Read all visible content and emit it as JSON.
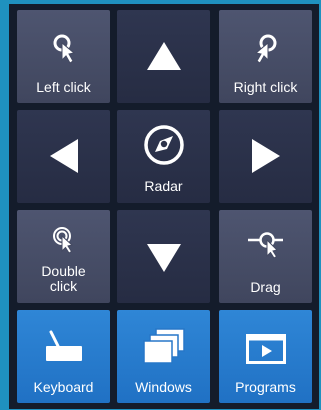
{
  "buttons": {
    "left_click": {
      "label": "Left click",
      "icon": "cursor-click-icon"
    },
    "up": {
      "icon": "arrow-up-icon"
    },
    "right_click": {
      "label": "Right click",
      "icon": "cursor-click-icon"
    },
    "left": {
      "icon": "arrow-left-icon"
    },
    "radar": {
      "label": "Radar",
      "icon": "radar-icon"
    },
    "right": {
      "icon": "arrow-right-icon"
    },
    "double_click": {
      "label_line1": "Double",
      "label_line2": "click",
      "icon": "cursor-double-click-icon"
    },
    "down": {
      "icon": "arrow-down-icon"
    },
    "drag": {
      "label": "Drag",
      "icon": "cursor-drag-icon"
    },
    "keyboard": {
      "label": "Keyboard",
      "icon": "keyboard-icon"
    },
    "windows": {
      "label": "Windows",
      "icon": "windows-stack-icon"
    },
    "programs": {
      "label": "Programs",
      "icon": "programs-icon"
    }
  },
  "colors": {
    "background": "#1f91bf",
    "panel": "#141c2b",
    "button_light": "#4a5169",
    "button_dark": "#2c3249",
    "button_blue": "#2a7fd0"
  }
}
